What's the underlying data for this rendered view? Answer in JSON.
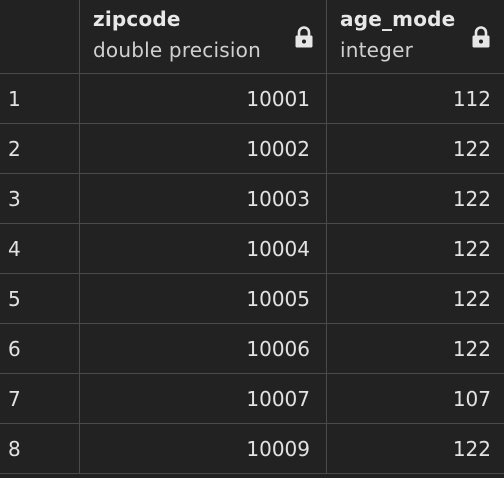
{
  "columns": [
    {
      "name": "zipcode",
      "type": "double precision",
      "locked_icon": "lock-icon"
    },
    {
      "name": "age_mode",
      "type": "integer",
      "locked_icon": "lock-icon"
    }
  ],
  "rows": [
    {
      "index": "1",
      "zipcode": "10001",
      "age_mode": "112"
    },
    {
      "index": "2",
      "zipcode": "10002",
      "age_mode": "122"
    },
    {
      "index": "3",
      "zipcode": "10003",
      "age_mode": "122"
    },
    {
      "index": "4",
      "zipcode": "10004",
      "age_mode": "122"
    },
    {
      "index": "5",
      "zipcode": "10005",
      "age_mode": "122"
    },
    {
      "index": "6",
      "zipcode": "10006",
      "age_mode": "122"
    },
    {
      "index": "7",
      "zipcode": "10007",
      "age_mode": "107"
    },
    {
      "index": "8",
      "zipcode": "10009",
      "age_mode": "122"
    }
  ],
  "colors": {
    "background": "#222222",
    "grid_line": "#4a4a4a",
    "text": "#e2e2e2"
  }
}
